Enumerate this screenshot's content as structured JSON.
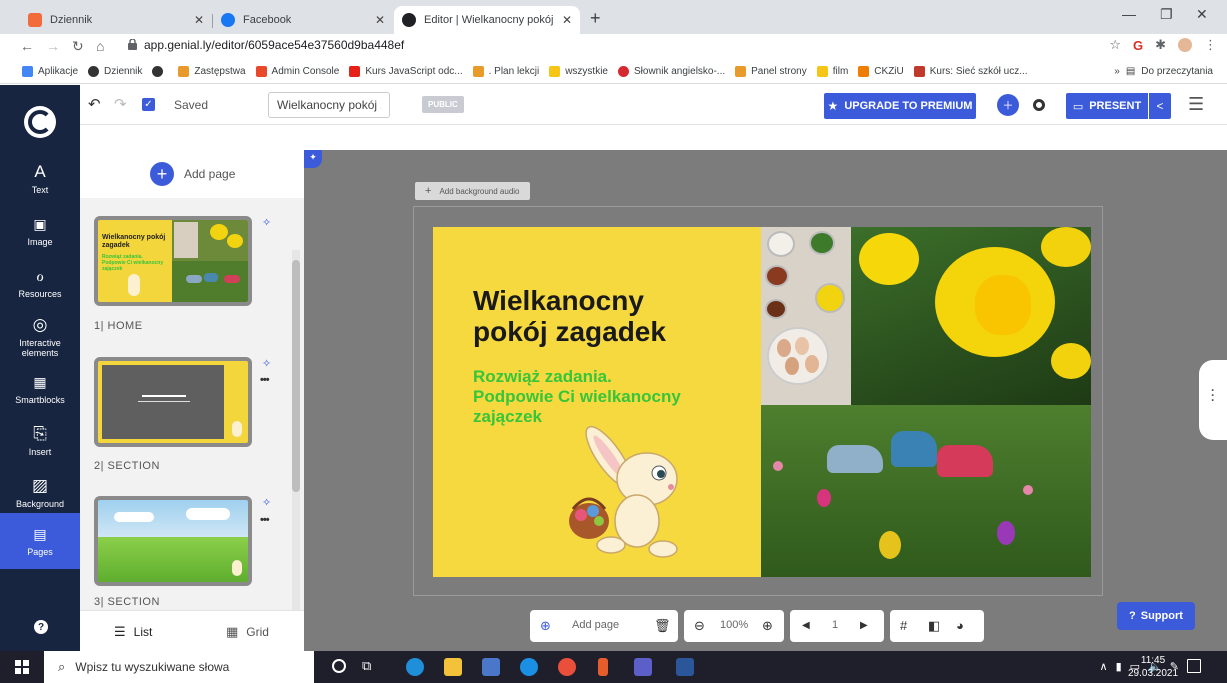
{
  "browser": {
    "tabs": [
      {
        "label": "Dziennik",
        "favicon_color": "#f26b3a"
      },
      {
        "label": "Facebook",
        "favicon_color": "#1877f2"
      },
      {
        "label": "Editor | Wielkanocny pokój zagad",
        "favicon_color": "#202124"
      }
    ],
    "url": "app.genial.ly/editor/6059ace54e37560d9ba448ef",
    "bookmarks": [
      {
        "label": "Aplikacje",
        "color": "#4285f4"
      },
      {
        "label": "Dziennik",
        "color": "#333333"
      },
      {
        "label": "",
        "color": "#333333"
      },
      {
        "label": "Zastępstwa",
        "color": "#e89a2b"
      },
      {
        "label": "Admin Console",
        "color": "#e8492b"
      },
      {
        "label": "Kurs JavaScript odc...",
        "color": "#e62117"
      },
      {
        "label": ". Plan lekcji",
        "color": "#e89a2b"
      },
      {
        "label": "wszystkie",
        "color": "#f5c518"
      },
      {
        "label": "Słownik angielsko-...",
        "color": "#d6282f"
      },
      {
        "label": "Panel strony",
        "color": "#e89a2b"
      },
      {
        "label": "film",
        "color": "#f5c518"
      },
      {
        "label": "CKZiU",
        "color": "#ef7d00"
      },
      {
        "label": "Kurs: Sieć szkół ucz...",
        "color": "#c0392b"
      }
    ],
    "reading_list": "Do przeczytania"
  },
  "app": {
    "nav": [
      {
        "label": "Text",
        "icon": "A"
      },
      {
        "label": "Image",
        "icon": "🖼"
      },
      {
        "label": "Resources",
        "icon": "⚘"
      },
      {
        "label": "Interactive elements",
        "icon": "◎"
      },
      {
        "label": "Smartblocks",
        "icon": "▦"
      },
      {
        "label": "Insert",
        "icon": "⎗"
      },
      {
        "label": "Background",
        "icon": "▨"
      },
      {
        "label": "Pages",
        "icon": "▤"
      }
    ],
    "saved": "Saved",
    "title_value": "Wielkanocny pokój zagad",
    "visibility": "PUBLIC",
    "upgrade": "UPGRADE TO PREMIUM",
    "present": "PRESENT",
    "add_page": "Add page",
    "pages": [
      {
        "label": "1| HOME"
      },
      {
        "label": "2| SECTION"
      },
      {
        "label": "3| SECTION"
      }
    ],
    "thumb1_title": "Wielkanocny pokój zagadek",
    "thumb1_sub": "Rozwiąż zadania. Podpowie Ci wielkanocny zajączek",
    "view_list": "List",
    "view_grid": "Grid",
    "bg_audio": "Add background audio",
    "slide": {
      "title": "Wielkanocny\npokój zagadek",
      "subtitle": "Rozwiąż zadania.\nPodpowie Ci wielkanocny\nzajączek"
    },
    "toolbar": {
      "add_page": "Add page",
      "zoom": "100%",
      "page_number": "1"
    },
    "support": "Support"
  },
  "taskbar": {
    "search_placeholder": "Wpisz tu wyszukiwane słowa",
    "time": "11:45",
    "date": "29.03.2021"
  },
  "colors": {
    "accent": "#3b5bdb",
    "nav_bg": "#172540",
    "slide_bg": "#f5d93f",
    "subtitle": "#37c53a"
  }
}
